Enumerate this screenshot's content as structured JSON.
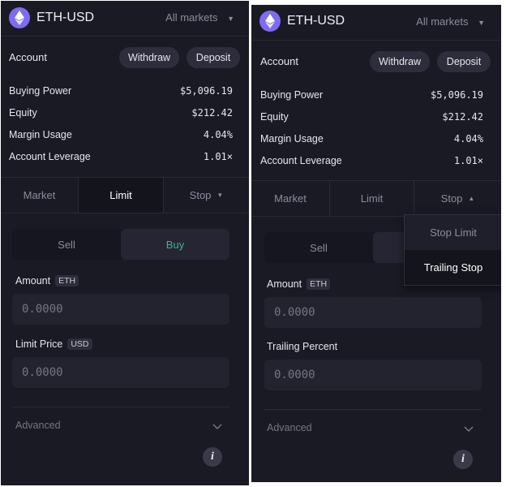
{
  "panels": [
    {
      "market": "ETH-USD",
      "markets_dropdown": "All markets",
      "account_label": "Account",
      "withdraw_label": "Withdraw",
      "deposit_label": "Deposit",
      "stats": [
        {
          "label": "Buying Power",
          "value": "$5,096.19"
        },
        {
          "label": "Equity",
          "value": "$212.42"
        },
        {
          "label": "Margin Usage",
          "value": "4.04%"
        },
        {
          "label": "Account Leverage",
          "value": "1.01×"
        }
      ],
      "tabs": {
        "market": "Market",
        "limit": "Limit",
        "stop": "Stop",
        "selected": "limit"
      },
      "side": {
        "sell": "Sell",
        "buy": "Buy",
        "selected": "buy"
      },
      "amount": {
        "label": "Amount",
        "unit": "ETH",
        "placeholder": "0.0000"
      },
      "second_field": {
        "label": "Limit Price",
        "unit": "USD",
        "placeholder": "0.0000"
      },
      "advanced_label": "Advanced",
      "info_label": "i"
    },
    {
      "market": "ETH-USD",
      "markets_dropdown": "All markets",
      "account_label": "Account",
      "withdraw_label": "Withdraw",
      "deposit_label": "Deposit",
      "stats": [
        {
          "label": "Buying Power",
          "value": "$5,096.19"
        },
        {
          "label": "Equity",
          "value": "$212.42"
        },
        {
          "label": "Margin Usage",
          "value": "4.04%"
        },
        {
          "label": "Account Leverage",
          "value": "1.01×"
        }
      ],
      "tabs": {
        "market": "Market",
        "limit": "Limit",
        "stop": "Stop",
        "selected": "stop"
      },
      "side": {
        "sell": "Sell"
      },
      "stop_menu": {
        "items": [
          "Stop Limit",
          "Trailing Stop"
        ],
        "selected": "Trailing Stop"
      },
      "amount": {
        "label": "Amount",
        "unit": "ETH",
        "placeholder": "0.0000"
      },
      "second_field": {
        "label": "Trailing Percent",
        "placeholder": "0.0000"
      },
      "advanced_label": "Advanced",
      "info_label": "i"
    }
  ],
  "colors": {
    "accent": "#7d6cf1",
    "buy": "#3fb68b",
    "panel_bg": "#1a1a25"
  }
}
